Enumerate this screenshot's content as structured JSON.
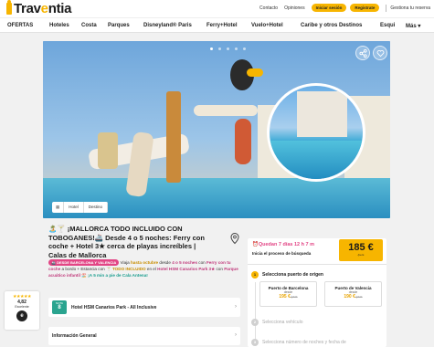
{
  "header": {
    "brand": {
      "prefix": "Trav",
      "o": "e",
      "suffix": "ntia"
    },
    "links": [
      "Contacto",
      "Opiniones"
    ],
    "login": "Iniciar sesión",
    "register": "Registrate",
    "agency": "Gestiona tu reserva"
  },
  "nav": [
    "OFERTAS",
    "Hoteles",
    "Costa",
    "Parques",
    "Disneyland® Paris",
    "Ferry+Hotel",
    "Vuelo+Hotel",
    "Caribe y otros Destinos",
    "Esqui",
    "Más"
  ],
  "hero": {
    "tabs": [
      "Hotel",
      "Destino"
    ],
    "slide_count": 5,
    "active_slide": 0
  },
  "offer": {
    "title": "🏝️🍸 ¡MALLORCA TODO INCLUIDO CON TOBOGANES!🚢 Desde 4 o 5 noches: Ferry con coche + Hotel 3★ cerca de playas increíbles | Calas de Mallorca",
    "badge": "🚢 DESDE BARCELONA Y VALENCIA",
    "desc_1": " Viaja ",
    "desc_hl1": "hasta octubre",
    "desc_2": " desde ",
    "desc_hl2": "4 o 5 noches",
    "desc_3": " con ",
    "desc_hl3": "Ferry con tu coche",
    "desc_4": " a bordo + Estancia con 🍸 ",
    "desc_hl4": "TODO INCLUIDO",
    "desc_5": " en el ",
    "desc_hl5": "Hotel HSM Canarios Park 3★",
    "desc_6": " con ",
    "desc_hl6": "Parque acuático infantil",
    "desc_7": " 🏖️ ",
    "desc_hl7": "¡A 5 min a pie de Cala Antena!"
  },
  "hotel": {
    "note_label": "NOTA",
    "note": "8",
    "name": "Hotel HSM Canarios Park - All Inclusive"
  },
  "info": {
    "title": "Información General"
  },
  "rating": {
    "stars": "★★★★★",
    "score": "4,82",
    "label": "Excelente"
  },
  "booking": {
    "countdown": "⏰Quedan 7 días 12 h 7 m",
    "process": "Inicia el proceso de búsqueda",
    "price": "185 €",
    "price_unit": "/pers",
    "step1": "Selecciona puerto de origen",
    "step2": "Selecciona vehículo",
    "step3": "Selecciona número de noches y fecha de",
    "ports": [
      {
        "name": "Puerto de Barcelona",
        "from": "desde",
        "price": "195 €",
        "old": "/pers"
      },
      {
        "name": "Puerto de Valencia",
        "from": "desde",
        "price": "190 €",
        "old": "/pers"
      }
    ]
  }
}
